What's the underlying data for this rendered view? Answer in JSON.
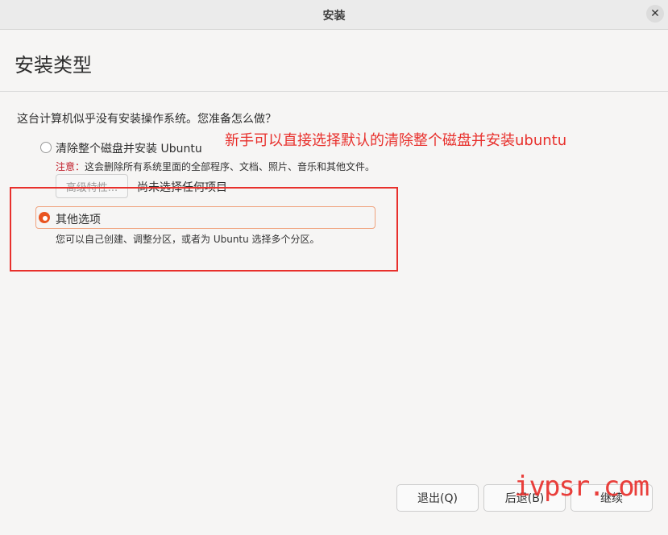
{
  "window": {
    "title": "安装",
    "close_icon": "close-icon"
  },
  "page": {
    "title": "安装类型"
  },
  "question": "这台计算机似乎没有安装操作系统。您准备怎么做？",
  "annotation": "新手可以直接选择默认的清除整个磁盘并安装ubuntu",
  "options": [
    {
      "label": "清除整个磁盘并安装 Ubuntu",
      "checked": false,
      "warning_label": "注意：",
      "warning_text": "这会删除所有系统里面的全部程序、文档、照片、音乐和其他文件。"
    },
    {
      "label": "其他选项",
      "checked": true,
      "description": "您可以自己创建、调整分区，或者为 Ubuntu 选择多个分区。"
    }
  ],
  "advanced": {
    "button_label": "高级特性...",
    "status": "尚未选择任何项目"
  },
  "buttons": {
    "quit": "退出(Q)",
    "back": "后退(B)",
    "continue": "继续"
  },
  "watermark": "ivpsr.com",
  "colors": {
    "accent": "#e95420",
    "annotation": "#e8302c"
  }
}
